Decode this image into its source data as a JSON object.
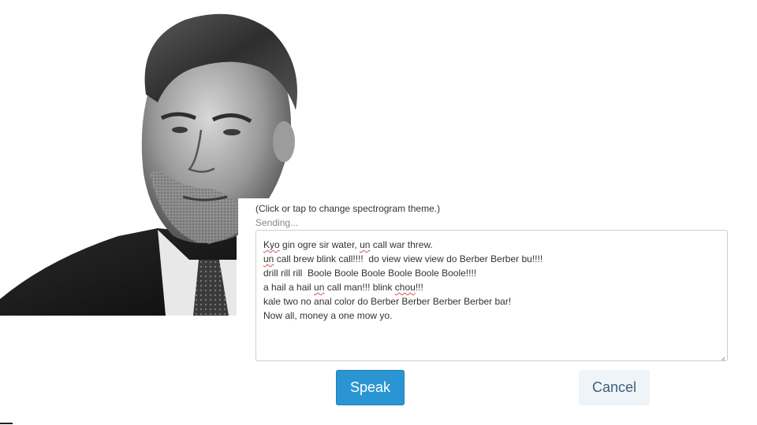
{
  "portrait": {
    "subject": "black-and-white portrait of a man in suit and tie"
  },
  "hint_text": "(Click or tap to change spectrogram theme.)",
  "status_text": "Sending...",
  "textarea": {
    "lines": [
      [
        {
          "t": "Kyo",
          "s": true
        },
        {
          "t": " gin ogre sir water, "
        },
        {
          "t": "un",
          "s": true
        },
        {
          "t": " call war threw."
        }
      ],
      [
        {
          "t": "un",
          "s": true
        },
        {
          "t": " call brew blink call!!!!  do view view view do Berber Berber bu!!!!"
        }
      ],
      [
        {
          "t": "drill rill rill  Boole Boole Boole Boole Boole Boole!!!!"
        }
      ],
      [
        {
          "t": "a hail a hail "
        },
        {
          "t": "un",
          "s": true
        },
        {
          "t": " call man!!! blink "
        },
        {
          "t": "chou",
          "s": true
        },
        {
          "t": "!!!"
        }
      ],
      [
        {
          "t": "kale two no anal color do Berber Berber Berber Berber bar!"
        }
      ],
      [
        {
          "t": "Now all, money a one mow yo."
        }
      ]
    ]
  },
  "buttons": {
    "speak_label": "Speak",
    "cancel_label": "Cancel"
  },
  "colors": {
    "speak_bg": "#2b95d3",
    "cancel_bg": "#eef4f8",
    "spellcheck_underline": "#d9534f"
  }
}
